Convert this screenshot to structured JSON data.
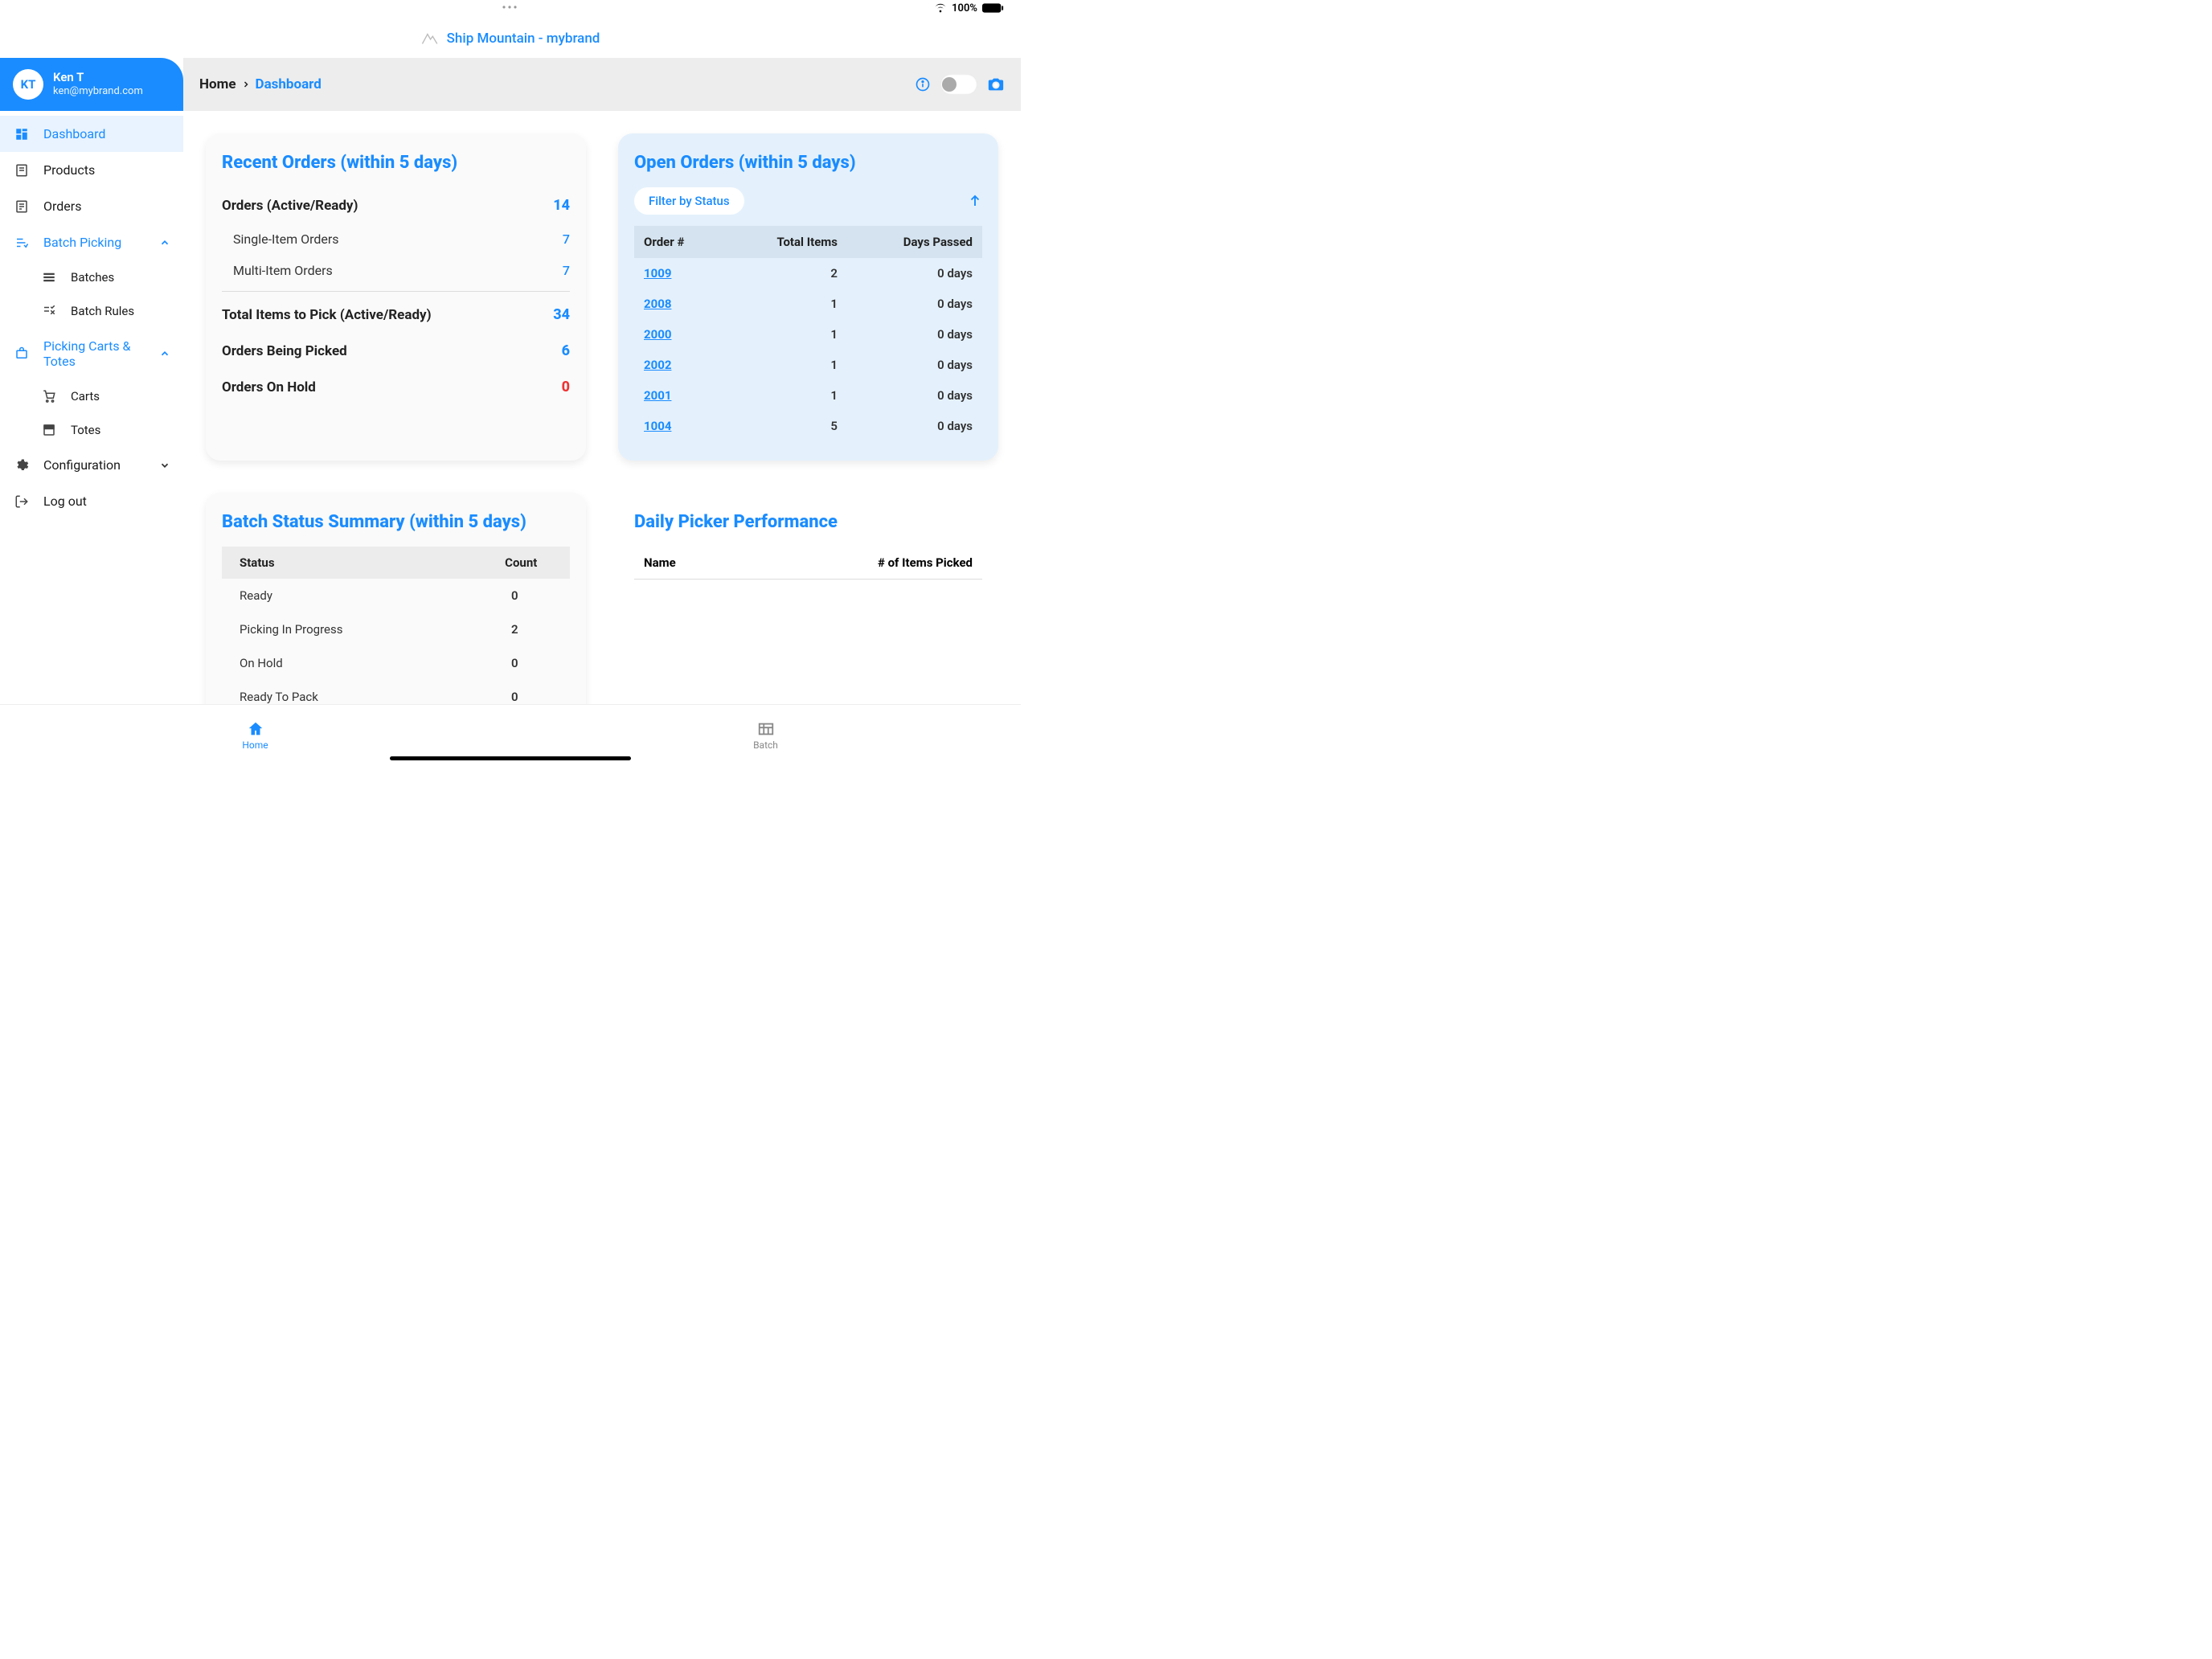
{
  "status": {
    "battery": "100%"
  },
  "header": {
    "title": "Ship Mountain - mybrand"
  },
  "breadcrumb": {
    "home": "Home",
    "current": "Dashboard"
  },
  "user": {
    "initials": "KT",
    "name": "Ken T",
    "email": "ken@mybrand.com"
  },
  "nav": {
    "dashboard": "Dashboard",
    "products": "Products",
    "orders": "Orders",
    "batch_picking": "Batch Picking",
    "batches": "Batches",
    "batch_rules": "Batch Rules",
    "picking_carts_totes": "Picking Carts & Totes",
    "carts": "Carts",
    "totes": "Totes",
    "configuration": "Configuration",
    "logout": "Log out"
  },
  "recent_orders": {
    "title": "Recent Orders (within 5 days)",
    "active_label": "Orders (Active/Ready)",
    "active_value": "14",
    "single_label": "Single-Item Orders",
    "single_value": "7",
    "multi_label": "Multi-Item Orders",
    "multi_value": "7",
    "total_items_label": "Total Items to Pick (Active/Ready)",
    "total_items_value": "34",
    "being_picked_label": "Orders Being Picked",
    "being_picked_value": "6",
    "on_hold_label": "Orders On Hold",
    "on_hold_value": "0"
  },
  "open_orders": {
    "title": "Open Orders (within 5 days)",
    "filter": "Filter by Status",
    "col_order": "Order #",
    "col_items": "Total Items",
    "col_days": "Days Passed",
    "rows": [
      {
        "order": "1009",
        "items": "2",
        "days": "0 days"
      },
      {
        "order": "2008",
        "items": "1",
        "days": "0 days"
      },
      {
        "order": "2000",
        "items": "1",
        "days": "0 days"
      },
      {
        "order": "2002",
        "items": "1",
        "days": "0 days"
      },
      {
        "order": "2001",
        "items": "1",
        "days": "0 days"
      },
      {
        "order": "1004",
        "items": "5",
        "days": "0 days"
      }
    ]
  },
  "batch_status": {
    "title": "Batch Status Summary (within 5 days)",
    "col_status": "Status",
    "col_count": "Count",
    "rows": [
      {
        "status": "Ready",
        "count": "0"
      },
      {
        "status": "Picking In Progress",
        "count": "2"
      },
      {
        "status": "On Hold",
        "count": "0"
      },
      {
        "status": "Ready To Pack",
        "count": "0"
      }
    ]
  },
  "picker_perf": {
    "title": "Daily Picker Performance",
    "col_name": "Name",
    "col_picked": "# of Items Picked"
  },
  "tabbar": {
    "home": "Home",
    "batch": "Batch"
  }
}
